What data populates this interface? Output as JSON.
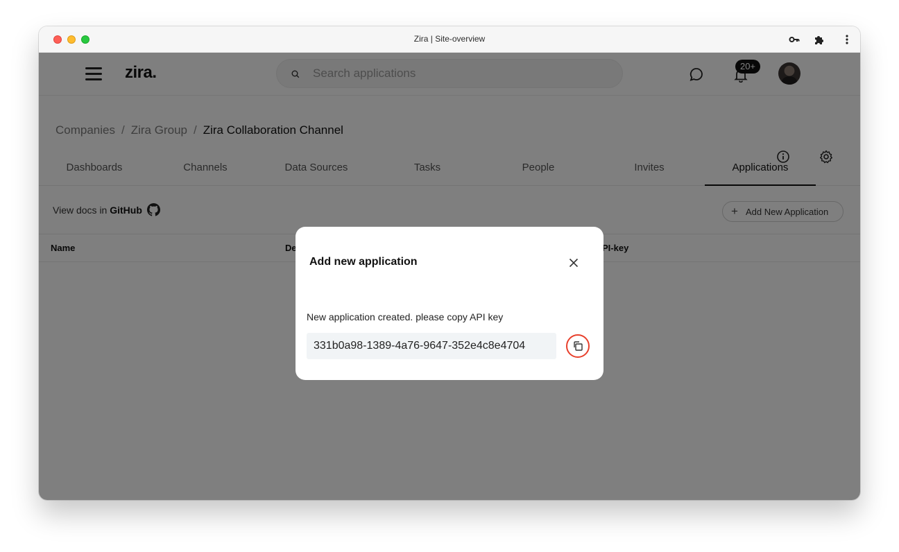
{
  "window": {
    "title": "Zira | Site-overview"
  },
  "header": {
    "logo": "zira.",
    "search": {
      "placeholder": "Search applications",
      "value": ""
    },
    "notifications_badge": "20+"
  },
  "breadcrumb": {
    "items": [
      "Companies",
      "Zira Group"
    ],
    "current": "Zira Collaboration Channel",
    "separator": "/"
  },
  "tabs": [
    {
      "label": "Dashboards",
      "active": false
    },
    {
      "label": "Channels",
      "active": false
    },
    {
      "label": "Data Sources",
      "active": false
    },
    {
      "label": "Tasks",
      "active": false
    },
    {
      "label": "People",
      "active": false
    },
    {
      "label": "Invites",
      "active": false
    },
    {
      "label": "Applications",
      "active": true
    }
  ],
  "toolbar": {
    "docs_prefix": "View docs in",
    "docs_link": "GitHub",
    "add_button": "Add New Application"
  },
  "table": {
    "columns": [
      "Name",
      "De",
      "PI-key"
    ]
  },
  "modal": {
    "title": "Add new application",
    "message": "New application created. please copy API key",
    "api_key": "331b0a98-1389-4a76-9647-352e4c8e4704"
  },
  "colors": {
    "overlay": "#808080",
    "copy_highlight": "#e8402c",
    "key_box_bg": "#f1f4f6"
  },
  "icons": [
    "key-icon",
    "puzzle-icon",
    "kebab-menu-icon",
    "search-icon",
    "chat-icon",
    "bell-icon",
    "info-icon",
    "gear-icon",
    "github-icon",
    "plus-icon",
    "close-icon",
    "copy-icon"
  ]
}
